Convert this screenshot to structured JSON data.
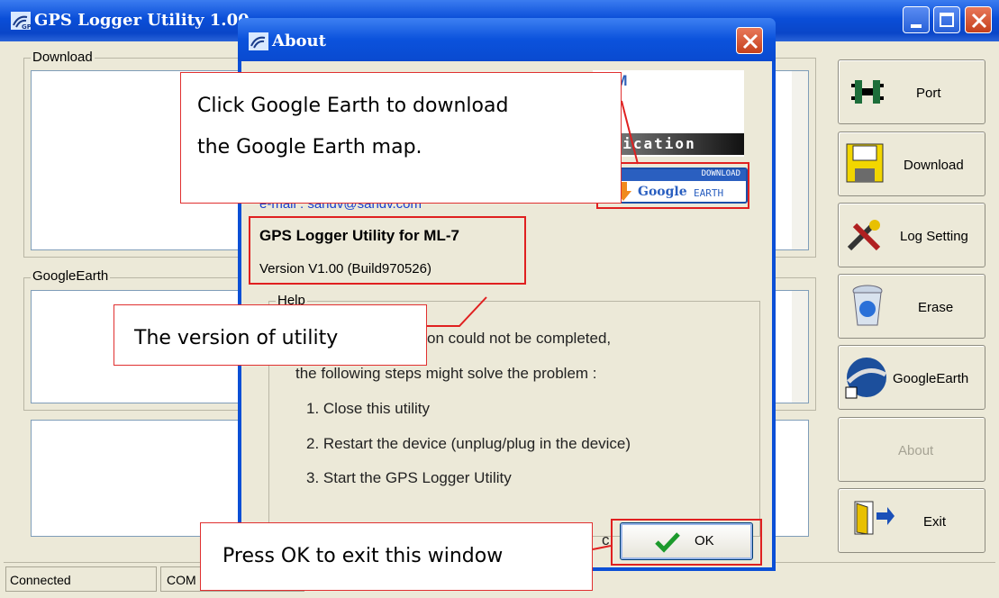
{
  "window": {
    "title": "GPS Logger Utility 1.00"
  },
  "groups": {
    "download": "Download",
    "googleearth": "GoogleEarth"
  },
  "side_buttons": {
    "port": "Port",
    "download": "Download",
    "log_setting": "Log Setting",
    "erase": "Erase",
    "googleearth": "GoogleEarth",
    "about": "About",
    "exit": "Exit"
  },
  "statusbar": {
    "connection": "Connected",
    "port": "COM"
  },
  "about": {
    "title": "About",
    "logo_tm": "TM",
    "logo_band_text": "unication",
    "email_text": "e-mail : sandv@sandv.com",
    "download_badge": {
      "top": "DOWNLOAD",
      "google": "Google",
      "earth": "EARTH"
    },
    "product_name": "GPS Logger Utility for ML-7",
    "version": "Version V1.00 (Build970526)",
    "help_label": "Help",
    "help_lines": [
      "on could not be completed,",
      "the following steps might solve the problem :",
      "1. Close this utility",
      "2. Restart the device (unplug/plug in the device)",
      "3. Start the GPS Logger Utility"
    ],
    "ok_label": "OK",
    "hidden_tail": "c."
  },
  "callouts": {
    "google_earth_1": "Click Google Earth to download",
    "google_earth_2": "the Google Earth map.",
    "version": "The version of utility",
    "ok": "Press OK to exit this window"
  }
}
